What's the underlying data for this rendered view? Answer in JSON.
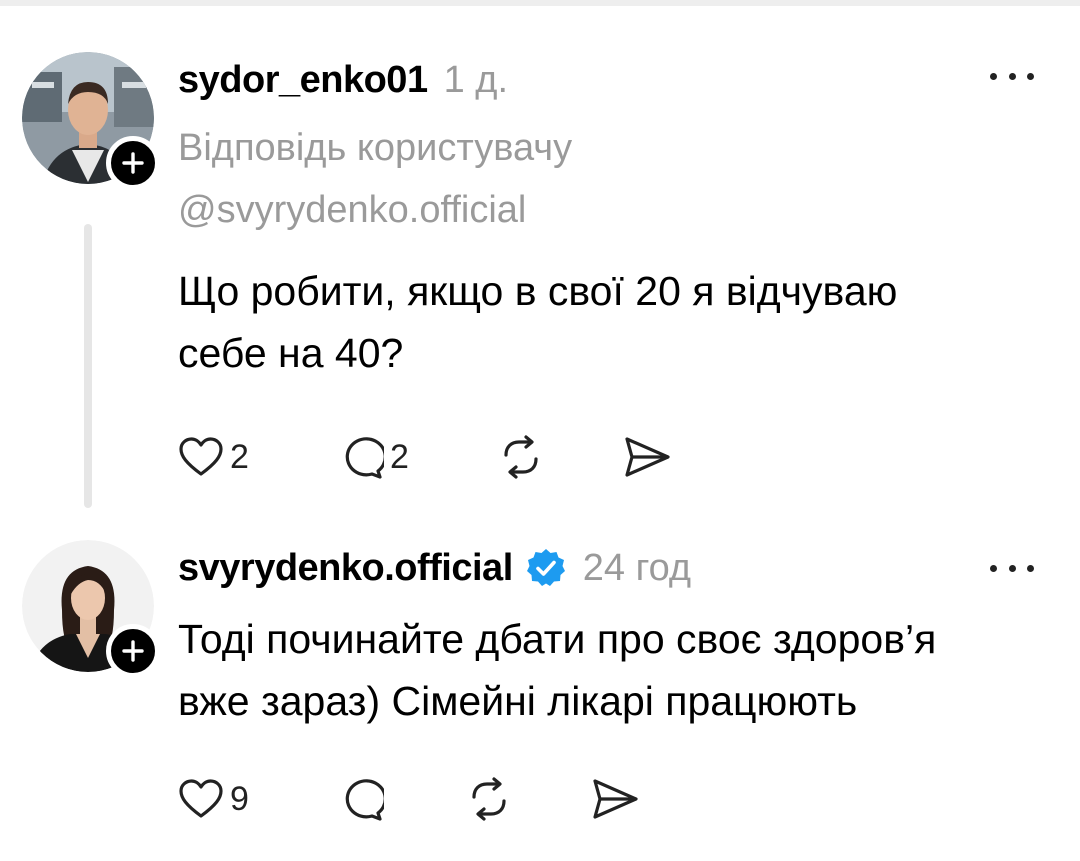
{
  "posts": [
    {
      "username": "sydor_enko01",
      "time": "1 д.",
      "reply_label": "Відповідь користувачу",
      "reply_to": "@svyrydenko.official",
      "text_line1": "Що робити, якщо в свої 20 я відчуваю",
      "text_line2": "себе на 40?",
      "likes": "2",
      "replies": "2"
    },
    {
      "username": "svyrydenko.official",
      "time": "24 год",
      "verified": true,
      "text_line1": "Тоді починайте дбати про своє здоров’я",
      "text_line2": "вже зараз) Сімейні лікарі працюють",
      "likes": "9",
      "replies": ""
    }
  ],
  "icons": {
    "like": "heart-icon",
    "comment": "comment-icon",
    "repost": "repost-icon",
    "share": "send-icon",
    "more": "more-icon",
    "follow": "plus-icon",
    "verified": "verified-badge-icon"
  },
  "colors": {
    "verified": "#1d9bf0",
    "muted": "#9a9a9a",
    "text": "#000000"
  }
}
